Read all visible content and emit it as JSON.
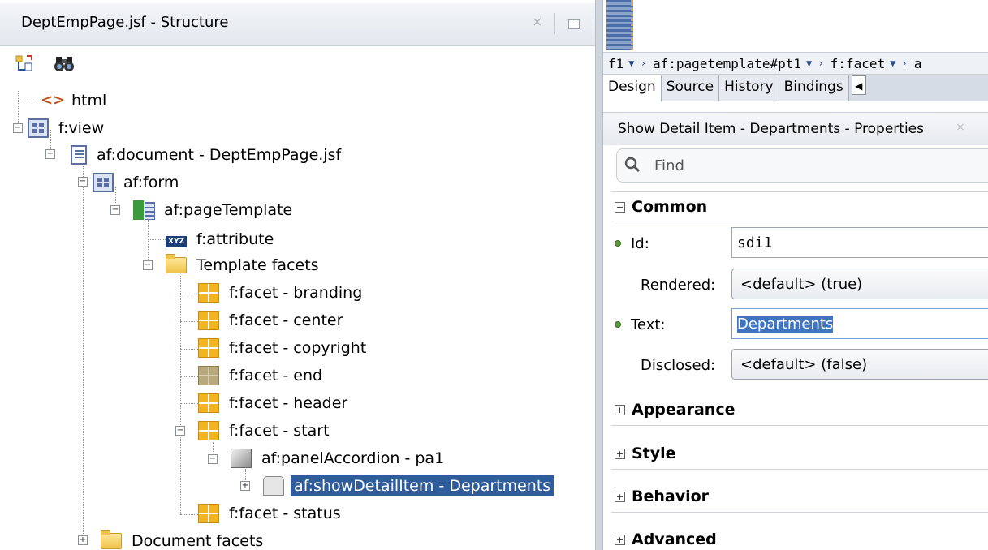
{
  "structure_panel": {
    "title": "DeptEmpPage.jsf - Structure",
    "close": "×",
    "tree": [
      {
        "label": "html",
        "icon": "html-tag-icon"
      },
      {
        "label": "f:view",
        "icon": "grid-icon"
      },
      {
        "label": "af:document - DeptEmpPage.jsf",
        "icon": "document-icon"
      },
      {
        "label": "af:form",
        "icon": "grid-icon"
      },
      {
        "label": "af:pageTemplate",
        "icon": "page-template-icon"
      },
      {
        "label": "f:attribute",
        "icon": "attribute-icon",
        "icon_text": "XYZ"
      },
      {
        "label": "Template facets",
        "icon": "folder-icon"
      },
      {
        "label": "f:facet - branding",
        "icon": "facet-icon"
      },
      {
        "label": "f:facet - center",
        "icon": "facet-icon"
      },
      {
        "label": "f:facet - copyright",
        "icon": "facet-icon"
      },
      {
        "label": "f:facet - end",
        "icon": "facet-empty-icon"
      },
      {
        "label": "f:facet - header",
        "icon": "facet-icon"
      },
      {
        "label": "f:facet - start",
        "icon": "facet-icon"
      },
      {
        "label": "af:panelAccordion - pa1",
        "icon": "panel-accordion-icon"
      },
      {
        "label": "af:showDetailItem - Departments",
        "icon": "show-detail-item-icon",
        "selected": true
      },
      {
        "label": "f:facet - status",
        "icon": "facet-icon"
      },
      {
        "label": "Document facets",
        "icon": "folder-icon"
      }
    ]
  },
  "editor": {
    "breadcrumbs": [
      "f1",
      "af:pagetemplate#pt1",
      "f:facet",
      "a"
    ],
    "tabs": [
      "Design",
      "Source",
      "History",
      "Bindings"
    ]
  },
  "properties": {
    "title": "Show Detail Item - Departments - Properties",
    "close": "×",
    "find_placeholder": "Find",
    "sections": {
      "common": "Common",
      "appearance": "Appearance",
      "style": "Style",
      "behavior": "Behavior",
      "advanced": "Advanced"
    },
    "fields": {
      "id": {
        "label": "Id:",
        "value": "sdi1"
      },
      "rendered": {
        "label": "Rendered:",
        "value": "<default> (true)"
      },
      "text": {
        "label": "Text:",
        "value": "Departments"
      },
      "disclosed": {
        "label": "Disclosed:",
        "value": "<default> (false)"
      }
    }
  },
  "colors": {
    "selection": "#2f5c9a",
    "facet": "#f3b51f",
    "folder": "#f1c24a"
  }
}
